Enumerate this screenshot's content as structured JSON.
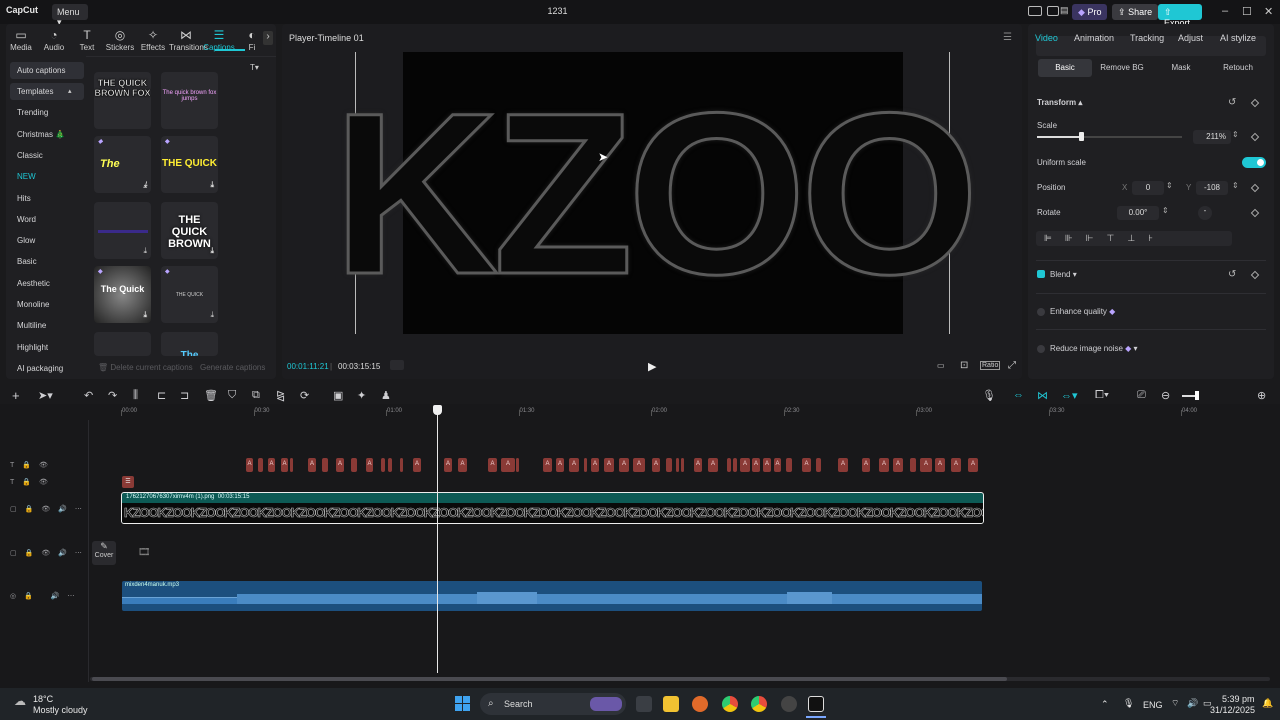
{
  "app": {
    "logo": "CapCut",
    "menu_label": "Menu",
    "project_title": "1231",
    "pro_label": "Pro",
    "share_label": "Share",
    "export_label": "Export",
    "accent": "#1fc7d4"
  },
  "left_panel": {
    "tabs": [
      {
        "icon": "media-icon",
        "label": "Media"
      },
      {
        "icon": "audio-icon",
        "label": "Audio"
      },
      {
        "icon": "text-icon",
        "label": "Text"
      },
      {
        "icon": "stickers-icon",
        "label": "Stickers"
      },
      {
        "icon": "effects-icon",
        "label": "Effects"
      },
      {
        "icon": "transitions-icon",
        "label": "Transitions"
      },
      {
        "icon": "captions-icon",
        "label": "Captions"
      },
      {
        "icon": "filters-icon",
        "label": "Fi"
      }
    ],
    "active_tab": "Captions",
    "categories": [
      "Auto captions",
      "Templates",
      "Trending",
      "Christmas 🎄",
      "Classic",
      "NEW",
      "Hits",
      "Word",
      "Glow",
      "Basic",
      "Aesthetic",
      "Monoline",
      "Multiline",
      "Highlight",
      "AI packaging"
    ],
    "selected_category": "Templates",
    "tiles": [
      {
        "text": "THE QUICK BROWN FOX"
      },
      {
        "text": "The quick brown fox jumps"
      },
      {
        "text": "The"
      },
      {
        "text": "THE QUICK"
      },
      {
        "text": ""
      },
      {
        "text": "THE QUICK BROWN"
      },
      {
        "text": "The Quick"
      },
      {
        "text": "THE QUICK"
      },
      {
        "text": ""
      },
      {
        "text": "The"
      }
    ],
    "delete_captions_label": "Delete current captions",
    "generate_captions_label": "Generate captions"
  },
  "player": {
    "title": "Player-Timeline 01",
    "video_text": "KZOO",
    "current_time": "00:01:11:21",
    "total_time": "00:03:15:15",
    "ratio_label": "Ratio"
  },
  "right_panel": {
    "tabs": [
      "Video",
      "Animation",
      "Tracking",
      "Adjust",
      "AI stylize"
    ],
    "active_tab": "Video",
    "subtabs": [
      "Basic",
      "Remove BG",
      "Mask",
      "Retouch"
    ],
    "active_subtab": "Basic",
    "transform_label": "Transform",
    "scale_label": "Scale",
    "scale_value": "211%",
    "scale_fraction": 0.3,
    "uniform_scale_label": "Uniform scale",
    "uniform_scale_on": true,
    "position_label": "Position",
    "x_label": "X",
    "x_value": "0",
    "y_label": "Y",
    "y_value": "-108",
    "rotate_label": "Rotate",
    "rotate_value": "0.00°",
    "blend_label": "Blend",
    "enhance_label": "Enhance quality",
    "reduce_noise_label": "Reduce image noise"
  },
  "timeline": {
    "ticks": [
      "00:00",
      "00:30",
      "01:00",
      "01:30",
      "02:00",
      "02:30",
      "03:00",
      "03:30",
      "04:00"
    ],
    "video_clip_name": "1762127067630​7xirnv4m (1).png",
    "video_clip_duration": "00:03:15:15",
    "clip_text": "KZOO",
    "audio_clip_name": "mixden4manuk.mp3",
    "cover_label": "Cover",
    "caption_clip_label": "A"
  },
  "taskbar": {
    "weather_temp": "18°C",
    "weather_desc": "Mostly cloudy",
    "search_label": "Search",
    "lang": "ENG",
    "time": "5:39 pm",
    "date": "31/12/2025"
  }
}
